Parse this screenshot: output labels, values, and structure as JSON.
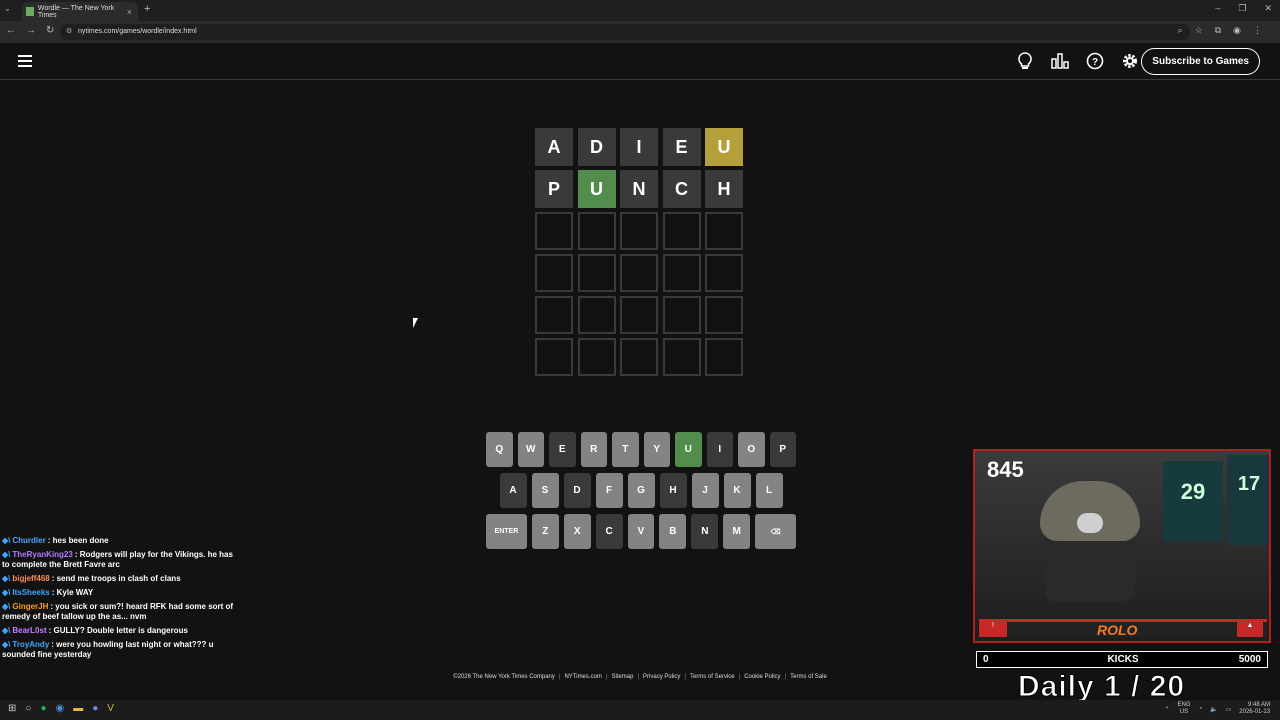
{
  "browser": {
    "tab_title": "Wordle — The New York Times",
    "url": "nytimes.com/games/wordle/index.html",
    "new_tab": "+",
    "tab_close": "×"
  },
  "header": {
    "subscribe_label": "Subscribe to Games"
  },
  "board": {
    "rows": [
      [
        {
          "l": "A",
          "s": "absent"
        },
        {
          "l": "D",
          "s": "absent"
        },
        {
          "l": "I",
          "s": "absent"
        },
        {
          "l": "E",
          "s": "absent"
        },
        {
          "l": "U",
          "s": "present"
        }
      ],
      [
        {
          "l": "P",
          "s": "absent"
        },
        {
          "l": "U",
          "s": "correct"
        },
        {
          "l": "N",
          "s": "absent"
        },
        {
          "l": "C",
          "s": "absent"
        },
        {
          "l": "H",
          "s": "absent"
        }
      ],
      [
        {
          "l": "",
          "s": "empty"
        },
        {
          "l": "",
          "s": "empty"
        },
        {
          "l": "",
          "s": "empty"
        },
        {
          "l": "",
          "s": "empty"
        },
        {
          "l": "",
          "s": "empty"
        }
      ],
      [
        {
          "l": "",
          "s": "empty"
        },
        {
          "l": "",
          "s": "empty"
        },
        {
          "l": "",
          "s": "empty"
        },
        {
          "l": "",
          "s": "empty"
        },
        {
          "l": "",
          "s": "empty"
        }
      ],
      [
        {
          "l": "",
          "s": "empty"
        },
        {
          "l": "",
          "s": "empty"
        },
        {
          "l": "",
          "s": "empty"
        },
        {
          "l": "",
          "s": "empty"
        },
        {
          "l": "",
          "s": "empty"
        }
      ],
      [
        {
          "l": "",
          "s": "empty"
        },
        {
          "l": "",
          "s": "empty"
        },
        {
          "l": "",
          "s": "empty"
        },
        {
          "l": "",
          "s": "empty"
        },
        {
          "l": "",
          "s": "empty"
        }
      ]
    ]
  },
  "keyboard": {
    "rows": [
      [
        {
          "k": "Q",
          "s": "unused"
        },
        {
          "k": "W",
          "s": "unused"
        },
        {
          "k": "E",
          "s": "absent"
        },
        {
          "k": "R",
          "s": "unused"
        },
        {
          "k": "T",
          "s": "unused"
        },
        {
          "k": "Y",
          "s": "unused"
        },
        {
          "k": "U",
          "s": "correct"
        },
        {
          "k": "I",
          "s": "absent"
        },
        {
          "k": "O",
          "s": "unused"
        },
        {
          "k": "P",
          "s": "absent"
        }
      ],
      [
        {
          "k": "A",
          "s": "absent"
        },
        {
          "k": "S",
          "s": "unused"
        },
        {
          "k": "D",
          "s": "absent"
        },
        {
          "k": "F",
          "s": "unused"
        },
        {
          "k": "G",
          "s": "unused"
        },
        {
          "k": "H",
          "s": "absent"
        },
        {
          "k": "J",
          "s": "unused"
        },
        {
          "k": "K",
          "s": "unused"
        },
        {
          "k": "L",
          "s": "unused"
        }
      ],
      [
        {
          "k": "ENTER",
          "s": "unused",
          "wide": true
        },
        {
          "k": "Z",
          "s": "unused"
        },
        {
          "k": "X",
          "s": "unused"
        },
        {
          "k": "C",
          "s": "absent"
        },
        {
          "k": "V",
          "s": "unused"
        },
        {
          "k": "B",
          "s": "unused"
        },
        {
          "k": "N",
          "s": "absent"
        },
        {
          "k": "M",
          "s": "unused"
        },
        {
          "k": "⌫",
          "s": "unused",
          "wide": true
        }
      ]
    ]
  },
  "chat": [
    {
      "user": "Churdler",
      "color": "#4fa3ff",
      "msg": "hes been done"
    },
    {
      "user": "TheRyanKing23",
      "color": "#b57cff",
      "msg": "Rodgers will play for the Vikings. he has to complete the Brett Favre arc"
    },
    {
      "user": "bigjeff468",
      "color": "#ff8c5a",
      "msg": "send me troops in clash of clans"
    },
    {
      "user": "ItsSheeks",
      "color": "#3ea6ff",
      "msg": "Kyle WAY"
    },
    {
      "user": "GingerJH",
      "color": "#ff9f1a",
      "msg": "you sick or sum?! heard RFK had some sort of remedy of beef tallow up the as... nvm"
    },
    {
      "user": "BearL0st",
      "color": "#c77dff",
      "msg": "GULLY? Double letter is dangerous"
    },
    {
      "user": "TroyAndy",
      "color": "#3ea6ff",
      "msg": "were you howling last night or what??? u sounded fine yesterday"
    }
  ],
  "overlay": {
    "count": "845",
    "jersey_1": "29",
    "jersey_2": "17",
    "logo": "ROLO",
    "kicks_min": "0",
    "kicks_label": "KICKS",
    "kicks_max": "5000",
    "daily": "Daily  1 / 20"
  },
  "footer": [
    "©2026 The New York Times Company",
    "NYTimes.com",
    "Sitemap",
    "Privacy Policy",
    "Terms of Service",
    "Cookie Policy",
    "Terms of Sale"
  ],
  "taskbar": {
    "lang_1": "ENG",
    "lang_2": "US",
    "time": "9:48 AM",
    "date": "2026-01-13"
  },
  "colors": {
    "correct": "#538d4e",
    "present": "#b59f3b",
    "absent": "#3a3a3c",
    "unused_key": "#818384"
  }
}
